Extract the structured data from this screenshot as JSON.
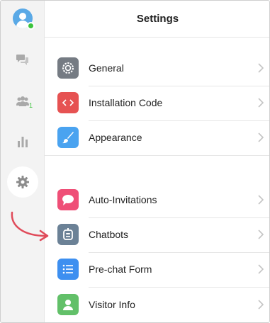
{
  "header": {
    "title": "Settings"
  },
  "sidebar": {
    "visitor_count": "1",
    "items": [
      {
        "icon": "chat-bubbles-icon"
      },
      {
        "icon": "visitors-icon"
      },
      {
        "icon": "reports-icon"
      },
      {
        "icon": "gear-icon",
        "active": true
      }
    ]
  },
  "settings": {
    "group1": [
      {
        "label": "General",
        "icon": "gear-icon",
        "color": "#757b83"
      },
      {
        "label": "Installation Code",
        "icon": "code-icon",
        "color": "#e65252"
      },
      {
        "label": "Appearance",
        "icon": "brush-icon",
        "color": "#4aa3f0"
      }
    ],
    "group2": [
      {
        "label": "Auto-Invitations",
        "icon": "speech-bubble-icon",
        "color": "#ef4f77"
      },
      {
        "label": "Chatbots",
        "icon": "robot-icon",
        "color": "#6b8196"
      },
      {
        "label": "Pre-chat Form",
        "icon": "list-icon",
        "color": "#3d8ff0"
      },
      {
        "label": "Visitor Info",
        "icon": "person-icon",
        "color": "#62c069"
      }
    ]
  },
  "colors": {
    "online": "#3cc33c",
    "arrow": "#e04b5a"
  }
}
